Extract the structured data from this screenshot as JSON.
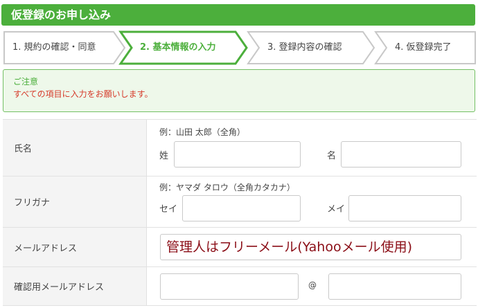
{
  "header": {
    "title": "仮登録のお申し込み"
  },
  "steps": [
    {
      "label": "1. 規約の確認・同意",
      "active": false
    },
    {
      "label": "2. 基本情報の入力",
      "active": true
    },
    {
      "label": "3. 登録内容の確認",
      "active": false
    },
    {
      "label": "4. 仮登録完了",
      "active": false
    }
  ],
  "notice": {
    "title": "ご注意",
    "text": "すべての項目に入力をお願いします。"
  },
  "form": {
    "name": {
      "label": "氏名",
      "hint": "例：山田 太郎（全角）",
      "sei_label": "姓",
      "mei_label": "名",
      "sei_value": "",
      "mei_value": ""
    },
    "furigana": {
      "label": "フリガナ",
      "hint": "例：ヤマダ タロウ（全角カタカナ）",
      "sei_label": "セイ",
      "mei_label": "メイ",
      "sei_value": "",
      "mei_value": ""
    },
    "email": {
      "label": "メールアドレス",
      "value": "管理人はフリーメール(Yahooメール使用)"
    },
    "email_confirm": {
      "label": "確認用メールアドレス",
      "at": "@",
      "local_value": "",
      "domain_value": ""
    }
  }
}
